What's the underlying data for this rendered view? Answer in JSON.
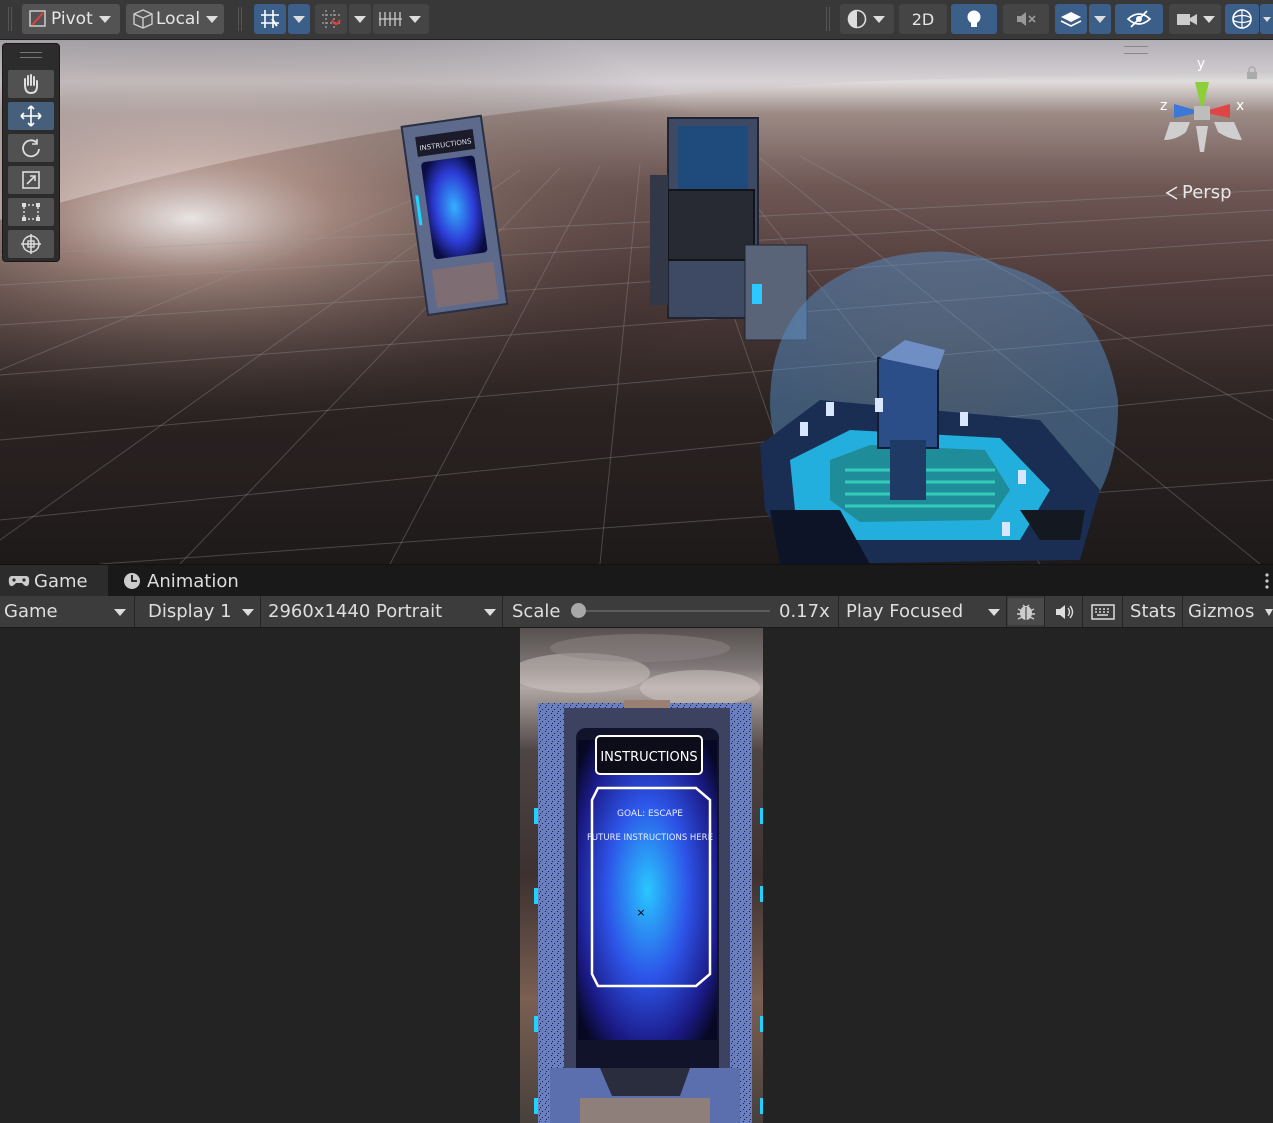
{
  "toolbar": {
    "pivot_label": "Pivot",
    "local_label": "Local",
    "mode_2d_label": "2D"
  },
  "scene": {
    "camera_label": "Persp",
    "gizmo_axes": {
      "y": "y",
      "x": "x",
      "z": "z"
    },
    "kiosk_small_text": "INSTRUCTIONS",
    "tools": [
      "hand-tool",
      "move-tool",
      "rotate-tool",
      "scale-tool",
      "rect-tool",
      "transform-tool"
    ]
  },
  "tabs": {
    "game_label": "Game",
    "animation_label": "Animation"
  },
  "gamebar": {
    "view_label": "Game",
    "display_label": "Display 1",
    "resolution_label": "2960x1440 Portrait",
    "scale_label": "Scale",
    "scale_value_label": "0.17x",
    "scale_fraction": 0.0,
    "play_mode_label": "Play Focused",
    "stats_label": "Stats",
    "gizmos_label": "Gizmos"
  },
  "game": {
    "panel_title": "INSTRUCTIONS",
    "goal_text": "GOAL: ESCAPE",
    "instructions_text": "FUTURE INSTRUCTIONS HERE",
    "crosshair": "×"
  },
  "colors": {
    "accent_blue": "#3c5f8a",
    "panel_glow": "#2aa8ff"
  }
}
